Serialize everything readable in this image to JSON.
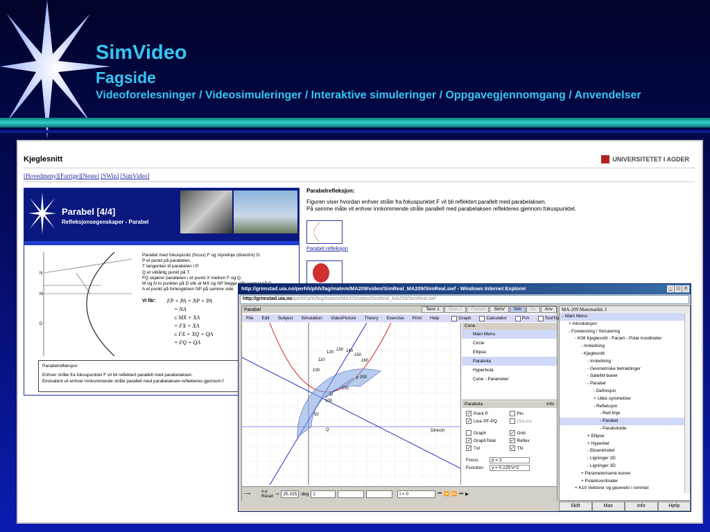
{
  "header": {
    "title": "SimVideo",
    "subtitle": "Fagside",
    "links": "Videoforelesninger / Videosimuleringer / Interaktive simuleringer / Oppgavegjennomgang / Anvendelser"
  },
  "page": {
    "title": "Kjeglesnitt",
    "university": "UNIVERSITETET I AGDER",
    "nav": [
      "[Hovedmeny]",
      "[Forrige]",
      "[Neste]",
      "[SWin]",
      "[SimVideo]"
    ],
    "section_title": "Parabelrefleksjon:",
    "text1": "Figuren viser hvordan enhver stråle fra fokuspunktet F vil bli reflektert parallelt med parabelaksen.",
    "text2": "På samme måte vil enhver innkommende stråle parallell med parabelaksen reflekteres gjennom fokuspunktet.",
    "thumb_link": "Parabel refleksjon"
  },
  "video": {
    "title": "Parabel   [4/4]",
    "subtitle": "Refleksjonsegenskaper  -  Parabel",
    "lines": [
      "Parabel med fokuspunkt (focus) F og styrelinje (directrix) D.",
      "P et punkt på parabelen.",
      "T tangenten til parabelen i P.",
      "Q et vilkårlig punkt på T.",
      "FQ skjærer parabelen i et punkt X mellom F og Q.",
      "M og N to punkter på D slik at MX og NP begge står normal på D.",
      "A et punkt på forlengelsen NP på samme side"
    ],
    "formula_label": "Vi får:",
    "formulas": [
      "FP + PA = NP + PA",
      "= NA",
      "≤ MX + XA",
      "= FX + XA",
      "≤ FX + XQ + QA",
      "= FQ + QA"
    ],
    "note_title": "Parabelrefleksjon:",
    "note1": "Enhver stråle fra fokuspunktet F vil bli reflektert parallelt med parabelaksen.",
    "note2": "Ekvivalent vil enhver innkommende stråle parallell med parabelaksen reflekteres gjennom f"
  },
  "ie": {
    "title": "http://grimstad.uia.no/perhh/phh/fag/matem/MA209/video/SimReal_MA209/SimReal.swf - Windows Internet Explorer",
    "url_host": "http://grimstad.uia.no",
    "url_path": "/perhh/phh/fag/matem/MA209/video/SimReal_MA209/SimReal.swf",
    "controls": [
      "_",
      "□",
      "×"
    ]
  },
  "sim": {
    "name": "Parabel",
    "top_buttons": [
      "Teori 1",
      "Teori 2",
      "Formel",
      "SimV",
      "Sim",
      "Ex",
      "Anv"
    ],
    "menu": [
      "File",
      "Edit",
      "Subject",
      "Simulation",
      "VideoPicture",
      "Theory",
      "Exercise",
      "Print",
      "Help"
    ],
    "checks_top": [
      "Graph",
      "Calculator",
      "PrA",
      "ToolTip"
    ],
    "cone_title": "Cone",
    "cone_items": [
      "Main Menu",
      "Circle",
      "Ellipse",
      "Parabola",
      "Hyperbola",
      "Cone - Parameter"
    ],
    "parabola_title": "Parabola",
    "info_label": "Info",
    "options": [
      {
        "label": "Point P",
        "on": true
      },
      {
        "label": "Pin",
        "on": false
      },
      {
        "label": "Line PF-PQ",
        "on": true
      },
      {
        "label": "PinLine",
        "on": false
      },
      {
        "label": "Graph",
        "on": false
      },
      {
        "label": "Grid",
        "on": true
      },
      {
        "label": "GraphTotal",
        "on": true
      },
      {
        "label": "Reflex",
        "on": true
      },
      {
        "label": "Txt",
        "on": true
      },
      {
        "label": "TN",
        "on": true
      }
    ],
    "focus_label": "Focus",
    "focus_value": "p = 2",
    "function_label": "Function",
    "function_value": "y = 0.125*x^2",
    "canvas_labels": {
      "P": "P",
      "Q": "Q",
      "F": "F",
      "directrix": "Directri",
      "ticks": [
        "50",
        "100",
        "150",
        "200",
        "100",
        "110",
        "120",
        "130",
        "140",
        "150",
        "160"
      ]
    },
    "bottom": {
      "xy": "x-y",
      "reset": "Reset",
      "angle": "25.325",
      "unit": "deg",
      "step": "1",
      "time": "t = 0"
    }
  },
  "tree": {
    "title": "MA-209  Matematikk 3",
    "items": [
      {
        "t": "-  Main Menu",
        "l": 0,
        "sel": true
      },
      {
        "t": "+  Introduksjon",
        "l": 1
      },
      {
        "t": "-  Forelesning / Simulering",
        "l": 1
      },
      {
        "t": "-  K08 Kjeglesnitt - Param - Polar koodinater",
        "l": 2
      },
      {
        "t": "-  Innledning",
        "l": 3
      },
      {
        "t": "-  Kjeglesnitt",
        "l": 3
      },
      {
        "t": "-  Innledning",
        "l": 4
      },
      {
        "t": "-  Geometriske betraktinger",
        "l": 4
      },
      {
        "t": "-  Satellitt-baner",
        "l": 4
      },
      {
        "t": "-  Parabel",
        "l": 4
      },
      {
        "t": "-  Definisjon",
        "l": 5
      },
      {
        "t": "+  Ulike symmetrier",
        "l": 5
      },
      {
        "t": "-  Refleksjon",
        "l": 5
      },
      {
        "t": "-  Rett linje",
        "l": 6
      },
      {
        "t": "-  Parabel",
        "l": 6,
        "sel": true
      },
      {
        "t": "-  Paraboloide",
        "l": 6
      },
      {
        "t": "+  Ellipse",
        "l": 4
      },
      {
        "t": "+  Hyperbel",
        "l": 4
      },
      {
        "t": "-  Eksentrisitet",
        "l": 4
      },
      {
        "t": "-  Ligninger 2D",
        "l": 4
      },
      {
        "t": "-  Ligninger 3D",
        "l": 4
      },
      {
        "t": "+  Parameteriserte kurver",
        "l": 3
      },
      {
        "t": "+  Polarkoordinater",
        "l": 3
      },
      {
        "t": "+  K10 Vektorer og geometri i rommet",
        "l": 2
      }
    ],
    "buttons": [
      "Skift",
      "Max",
      "Info",
      "Hjelp"
    ]
  },
  "colors": {
    "accent": "#33c7f2",
    "band": "#33d1c8",
    "slide": "#040a5a"
  }
}
